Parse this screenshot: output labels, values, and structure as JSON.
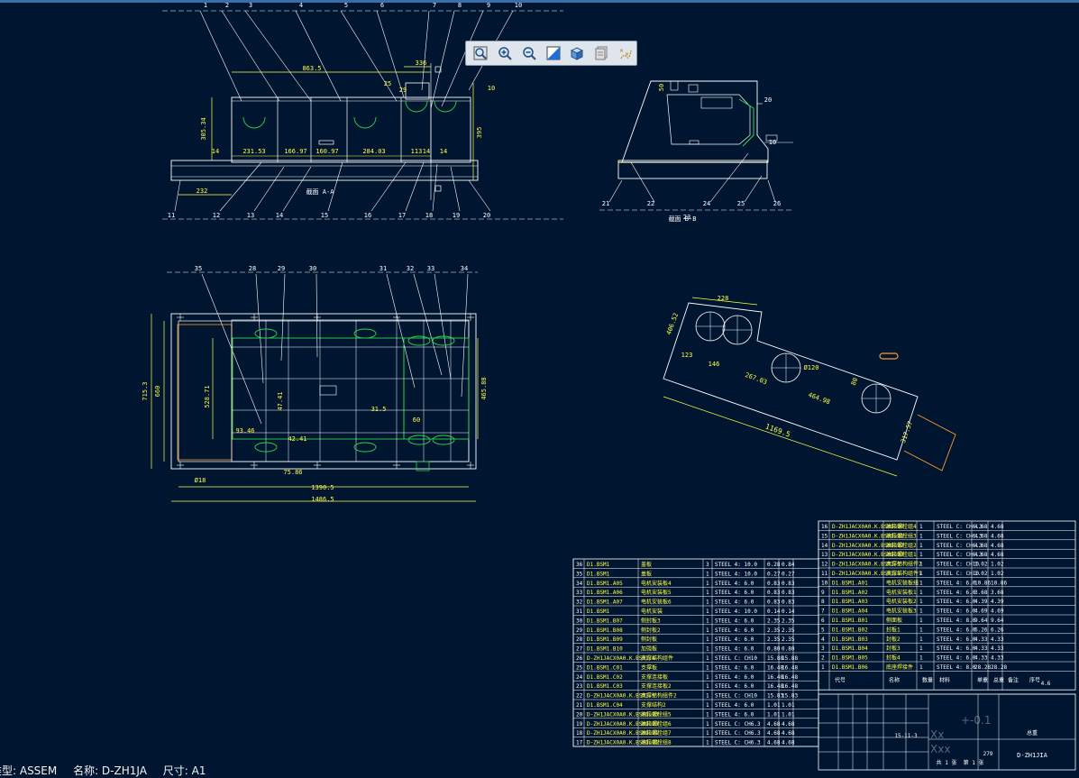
{
  "status_bar": {
    "type_text": "类型: ASSEM",
    "name_text": "名称: D-ZH1JA",
    "size_text": "尺寸: A1"
  },
  "toolbar": {
    "tools": [
      {
        "id": "zoom-fit",
        "icon": "magnifier-fit-icon"
      },
      {
        "id": "zoom-in",
        "icon": "magnifier-plus-icon"
      },
      {
        "id": "zoom-out",
        "icon": "magnifier-minus-icon"
      },
      {
        "id": "repaint",
        "icon": "repaint-icon"
      },
      {
        "id": "shading",
        "icon": "cube-shading-icon"
      },
      {
        "id": "layers",
        "icon": "layers-icon"
      },
      {
        "id": "datum",
        "icon": "datum-display-icon"
      }
    ]
  },
  "colors": {
    "background": "#001530",
    "lines": "#ffffff",
    "dimensions": "#ffff4a",
    "highlight": "#2bd84a",
    "accent": "#ff9a2a"
  },
  "view_front": {
    "balloons_top": [
      "1",
      "2",
      "3",
      "4",
      "5",
      "6",
      "7",
      "8",
      "9",
      "10"
    ],
    "balloons_bottom": [
      "11",
      "12",
      "13",
      "14",
      "15",
      "16",
      "17",
      "18",
      "19",
      "20"
    ],
    "dims": [
      "863.5",
      "336",
      "25",
      "29",
      "10",
      "305.34",
      "395",
      "14",
      "231.53",
      "166.97",
      "160.97",
      "284.03",
      "113",
      "14",
      "14",
      "232"
    ],
    "section_label": "截面 A-A"
  },
  "view_side": {
    "balloons": [
      "21",
      "22",
      "23",
      "24",
      "25",
      "26",
      "20",
      "10"
    ],
    "dims": [
      "50"
    ],
    "section_label": "截面 B-B"
  },
  "view_top": {
    "balloons": [
      "35",
      "28",
      "29",
      "30",
      "31",
      "32",
      "33",
      "34"
    ],
    "dims": [
      "715.3",
      "660",
      "528.71",
      "465.88",
      "47.41",
      "31.5",
      "60",
      "93.46",
      "42.41",
      "75.86",
      "1390.5",
      "1486.5",
      "Ø18"
    ]
  },
  "view_iso": {
    "dims": [
      "228",
      "406.52",
      "123",
      "146",
      "267.03",
      "464.98",
      "Ø120",
      "80",
      "1169.5",
      "317.57"
    ]
  },
  "bom_right": [
    [
      "16",
      "D-ZH1JACX0A0.K.BSM1.10",
      "油箱螺栓组4",
      "1",
      "STEEL C: CH6.3",
      "4.68",
      "4.68"
    ],
    [
      "15",
      "D-ZH1JACX0A0.K.BSM1.11",
      "油箱螺栓组3",
      "1",
      "STEEL C: CH6.3",
      "4.68",
      "4.68"
    ],
    [
      "14",
      "D-ZH1JACX0A0.K.BSM1.12",
      "油箱螺栓组2",
      "1",
      "STEEL C: CH6.3",
      "4.68",
      "4.68"
    ],
    [
      "13",
      "D-ZH1JACX0A0.K.BSM1.13",
      "油箱螺栓组1",
      "1",
      "STEEL C: CH6.3",
      "4.68",
      "4.68"
    ],
    [
      "12",
      "D-ZH1JACX0A0.K.BSM1.1",
      "支撑结构组件2",
      "1",
      "STEEL C: CH10",
      "1.02",
      "1.02"
    ],
    [
      "11",
      "D-ZH1JACX0A0.K.BSM1.1",
      "支撑结构组件1",
      "1",
      "STEEL C: CH10",
      "1.02",
      "1.02"
    ],
    [
      "10",
      "D1.BSM1.A01",
      "电机安装板组",
      "1",
      "STEEL 4: 6.0",
      "10.86",
      "10.86"
    ],
    [
      "9",
      "D1.BSM1.A02",
      "电机安装板1",
      "1",
      "STEEL 4: 6.0",
      "3.68",
      "3.68"
    ],
    [
      "8",
      "D1.BSM1.A03",
      "电机安装板2",
      "1",
      "STEEL 4: 6.0",
      "4.39",
      "4.39"
    ],
    [
      "7",
      "D1.BSM1.A04",
      "电机安装板3",
      "1",
      "STEEL 4: 6.0",
      "4.69",
      "4.69"
    ],
    [
      "6",
      "D1.BSM1.B01",
      "侧面板",
      "1",
      "STEEL 4: 8.0",
      "9.64",
      "9.64"
    ],
    [
      "5",
      "D1.BSM1.B02",
      "封板1",
      "1",
      "STEEL 4: 6.0",
      "6.26",
      "6.26"
    ],
    [
      "4",
      "D1.BSM1.B03",
      "封板2",
      "1",
      "STEEL 4: 6.0",
      "4.33",
      "4.33"
    ],
    [
      "3",
      "D1.BSM1.B04",
      "封板3",
      "1",
      "STEEL 4: 6.0",
      "4.33",
      "4.33"
    ],
    [
      "2",
      "D1.BSM1.B05",
      "封板4",
      "1",
      "STEEL 4: 6.0",
      "4.33",
      "4.33"
    ],
    [
      "1",
      "D1.BSM1.B06",
      "底座焊接件",
      "1",
      "STEEL 4: 8.0",
      "28.28",
      "28.28"
    ]
  ],
  "bom_left": [
    [
      "36",
      "D1.BSM1",
      "盖板",
      "3",
      "STEEL 4: 10.0",
      "0.28",
      "0.84"
    ],
    [
      "35",
      "D1.BSM1",
      "盖板",
      "1",
      "STEEL 4: 10.0",
      "0.27",
      "0.27"
    ],
    [
      "34",
      "D1.BSM1.A05",
      "电机安装板4",
      "1",
      "STEEL 4: 6.0",
      "0.83",
      "0.83"
    ],
    [
      "33",
      "D1.BSM1.A06",
      "电机安装板5",
      "1",
      "STEEL 4: 6.0",
      "0.83",
      "0.83"
    ],
    [
      "32",
      "D1.BSM1.A07",
      "电机安装板6",
      "1",
      "STEEL 4: 6.0",
      "0.83",
      "0.83"
    ],
    [
      "31",
      "D1.BSM1",
      "电机安装",
      "1",
      "STEEL 4: 10.0",
      "0.14",
      "0.14"
    ],
    [
      "30",
      "D1.BSM1.B07",
      "侧封板3",
      "1",
      "STEEL 4: 6.0",
      "2.35",
      "2.35"
    ],
    [
      "29",
      "D1.BSM1.B08",
      "侧封板2",
      "1",
      "STEEL 4: 6.0",
      "2.35",
      "2.35"
    ],
    [
      "28",
      "D1.BSM1.B09",
      "侧封板",
      "1",
      "STEEL 4: 6.0",
      "2.35",
      "2.35"
    ],
    [
      "27",
      "D1.BSM1.B10",
      "加强板",
      "1",
      "STEEL 4: 6.0",
      "0.80",
      "0.80"
    ],
    [
      "26",
      "D-ZH1JACX0A0.K.BSM1.4",
      "支撑结构组件",
      "1",
      "STEEL C: CH10",
      "15.88",
      "15.88"
    ],
    [
      "25",
      "D1.BSM1.C01",
      "支撑板",
      "1",
      "STEEL 4: 6.0",
      "16.48",
      "16.48"
    ],
    [
      "24",
      "D1.BSM1.C02",
      "支撑连接板",
      "1",
      "STEEL 4: 6.0",
      "16.48",
      "16.48"
    ],
    [
      "23",
      "D1.BSM1.C03",
      "支撑连接板2",
      "1",
      "STEEL 4: 6.0",
      "16.48",
      "16.48"
    ],
    [
      "22",
      "D-ZH1JACX0A0.K.BSM1.5",
      "支撑结构组件2",
      "1",
      "STEEL C: CH10",
      "15.83",
      "15.83"
    ],
    [
      "21",
      "D1.BSM1.C04",
      "支撑结构2",
      "1",
      "STEEL 4: 6.0",
      "1.01",
      "1.01"
    ],
    [
      "20",
      "D-ZH1JACX0A0.K.BSM1.23",
      "油箱螺栓组5",
      "1",
      "STEEL 4: 6.0",
      "1.01",
      "1.01"
    ],
    [
      "19",
      "D-ZH1JACX0A0.K.BSM1.23",
      "油箱螺栓组6",
      "1",
      "STEEL C: CH6.3",
      "4.68",
      "4.68"
    ],
    [
      "18",
      "D-ZH1JACX0A0.K.BSM1.21",
      "油箱螺栓组7",
      "1",
      "STEEL C: CH6.3",
      "4.68",
      "4.68"
    ],
    [
      "17",
      "D-ZH1JACX0A0.K.BSM1.21",
      "油箱螺栓组8",
      "1",
      "STEEL C: CH6.3",
      "4.68",
      "4.68"
    ]
  ],
  "bom_header": [
    "序号",
    "代号",
    "名称",
    "数量",
    "材料",
    "单重",
    "总重",
    "备注"
  ],
  "title_block": {
    "drawing_no": "D-ZH1JIA",
    "unit": "共 1 张",
    "weight_label": "总重",
    "sheet_text": "第 1 张",
    "weight_value": "279",
    "date": "15-11-3",
    "extra": "4.6"
  },
  "watermark": {
    "line1": "+-0.1",
    "line2": "Xx",
    "line3": "Xxx"
  }
}
